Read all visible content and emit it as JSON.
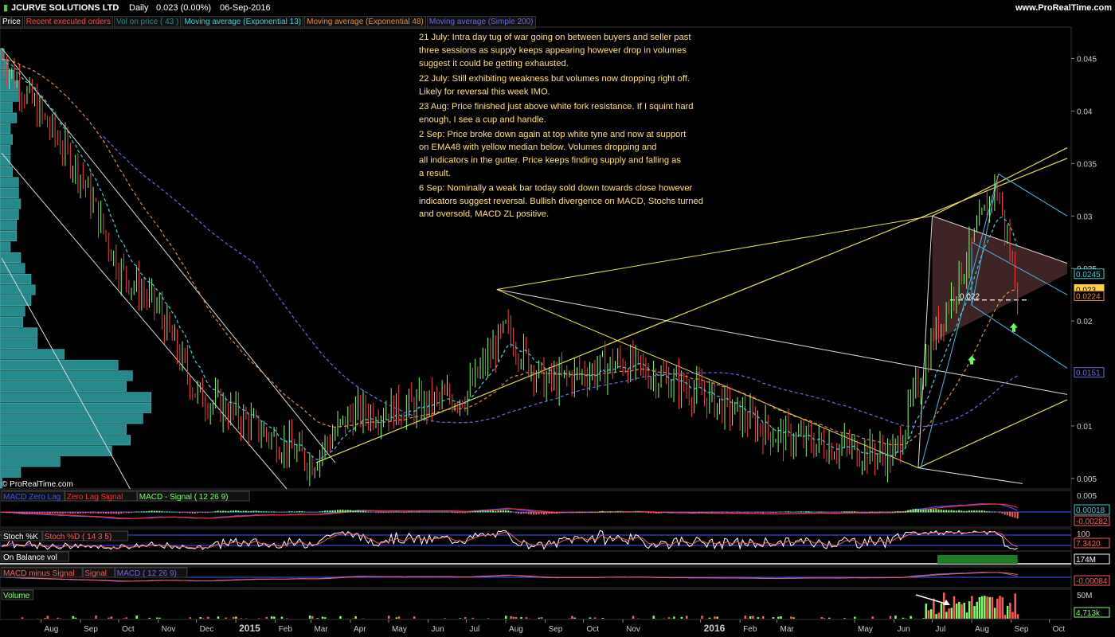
{
  "header": {
    "instrument": "JCURVE SOLUTIONS LTD",
    "period": "Daily",
    "quote": "0.023 (0.00%)",
    "date": "06-Sep-2016",
    "site": "www.ProRealTime.com"
  },
  "legend": [
    {
      "label": "Price",
      "color": "#ffffff"
    },
    {
      "label": "Recent executed orders",
      "color": "#ff4444"
    },
    {
      "label": "Vol on price ( 43 )",
      "color": "#2e8b8b"
    },
    {
      "label": "Moving average (Exponential 13)",
      "color": "#35d0d8"
    },
    {
      "label": "Moving average (Exponential 48)",
      "color": "#e08a3c"
    },
    {
      "label": "Moving average (Simple 200)",
      "color": "#6a6ae8"
    }
  ],
  "copyright": "© ProRealTime.com",
  "annotations": [
    "21 July: Intra day tug of war going on between buyers and seller past",
    "three sessions as supply keeps appearing however drop in volumes",
    "suggest it could be getting exhausted.",
    "22 July: Still exhibiting weakness but volumes now dropping right off.",
    "Likely for reversal this week IMO.",
    "23 Aug: Price finished just above white fork resistance. If I squint hard",
    "enough, I see a cup and handle.",
    "  2 Sep: Price broke down again at top white tyne and now at support",
    "  on EMA48 with yellow median below. Volumes dropping and",
    "  all indicators in the gutter. Price keeps finding supply and falling as",
    "   a result.",
    "6 Sep: Nominally a weak bar today sold down towards close however",
    "indicators suggest reversal. Bullish divergence on MACD, Stochs turned",
    "and oversold, MACD ZL positive."
  ],
  "price_level_label": "0.022",
  "right_axis": {
    "ticks": [
      "0.045",
      "0.04",
      "0.035",
      "0.03",
      "0.025",
      "0.02",
      "0.01",
      "0.005"
    ],
    "badges": [
      {
        "text": "0.0245",
        "color": "#35d0d8"
      },
      {
        "text": "0.023",
        "color": "#ffd23c"
      },
      {
        "text": "0.0224",
        "color": "#e08a3c"
      },
      {
        "text": "0.0151",
        "color": "#6a6ae8"
      }
    ]
  },
  "x_axis": [
    "Aug",
    "Sep",
    "Oct",
    "Nov",
    "Dec",
    "2015",
    "Feb",
    "Mar",
    "Apr",
    "May",
    "Jun",
    "Jul",
    "Aug",
    "Sep",
    "Oct",
    "Nov",
    "2016",
    "Feb",
    "Mar",
    "May",
    "Jun",
    "Jul",
    "Aug",
    "Sep",
    "Oct"
  ],
  "panels": {
    "zerolag": {
      "labels": [
        {
          "text": "MACD Zero Lag",
          "color": "#3a56ff"
        },
        {
          "text": "Zero Lag Signal",
          "color": "#ff2a2a"
        },
        {
          "text": "MACD - Signal ( 12 26 9)",
          "color": "#7cff6a"
        }
      ],
      "axis": [
        "0.005"
      ],
      "badges": [
        {
          "text": "0.00018",
          "color": "#35d0d8"
        },
        {
          "text": "-0.00282",
          "color": "#ff5a5a"
        }
      ]
    },
    "stoch": {
      "labels": [
        {
          "text": "Stoch %K",
          "color": "#ffffff"
        },
        {
          "text": "Stoch %D ( 14 3 5)",
          "color": "#ff5a5a"
        }
      ],
      "axis": [
        "100"
      ],
      "badges": [
        {
          "text": "7.3420",
          "color": "#ff5a5a"
        }
      ]
    },
    "obv": {
      "labels": [
        {
          "text": "On Balance vol",
          "color": "#ffffff"
        }
      ],
      "badges": [
        {
          "text": "174M",
          "color": "#ffffff"
        }
      ]
    },
    "macd": {
      "labels": [
        {
          "text": "MACD minus Signal",
          "color": "#ff5a5a"
        },
        {
          "text": "Signal",
          "color": "#ff5a5a"
        },
        {
          "text": "MACD ( 12 26 9)",
          "color": "#6a6ae8"
        }
      ],
      "badges": [
        {
          "text": "-0.00084",
          "color": "#ff5a5a"
        }
      ]
    },
    "volume": {
      "labels": [
        {
          "text": "Volume",
          "color": "#7cff6a"
        }
      ],
      "axis": [
        "50M"
      ],
      "badges": [
        {
          "text": "4,713k",
          "color": "#7cff6a"
        }
      ]
    }
  },
  "chart_data": {
    "type": "candlestick",
    "title": "JCURVE SOLUTIONS LTD",
    "period": "Daily",
    "last_close": 0.023,
    "ylim": [
      0.004,
      0.048
    ],
    "x_range": [
      "2014-07",
      "2016-10"
    ],
    "key_points": [
      {
        "date": "2014-07",
        "close": 0.045
      },
      {
        "date": "2014-09",
        "close": 0.034
      },
      {
        "date": "2014-10",
        "close": 0.025
      },
      {
        "date": "2014-11",
        "close": 0.021
      },
      {
        "date": "2014-12",
        "close": 0.013
      },
      {
        "date": "2015-01",
        "close": 0.011
      },
      {
        "date": "2015-03",
        "close": 0.0065
      },
      {
        "date": "2015-04",
        "close": 0.011
      },
      {
        "date": "2015-06",
        "close": 0.012
      },
      {
        "date": "2015-07",
        "close": 0.013
      },
      {
        "date": "2015-08",
        "close": 0.019
      },
      {
        "date": "2015-09",
        "close": 0.014
      },
      {
        "date": "2015-11",
        "close": 0.016
      },
      {
        "date": "2016-01",
        "close": 0.013
      },
      {
        "date": "2016-03",
        "close": 0.009
      },
      {
        "date": "2016-06",
        "close": 0.007
      },
      {
        "date": "2016-07",
        "close": 0.018
      },
      {
        "date": "2016-08",
        "close": 0.027
      },
      {
        "date": "2016-08-20",
        "close": 0.033
      },
      {
        "date": "2016-09-06",
        "close": 0.023
      }
    ],
    "indicator_values": {
      "ema13": 0.0245,
      "ema48": 0.0224,
      "sma200": 0.0151,
      "support_level": 0.022
    },
    "grid": false,
    "legend_placement": "top-left"
  }
}
